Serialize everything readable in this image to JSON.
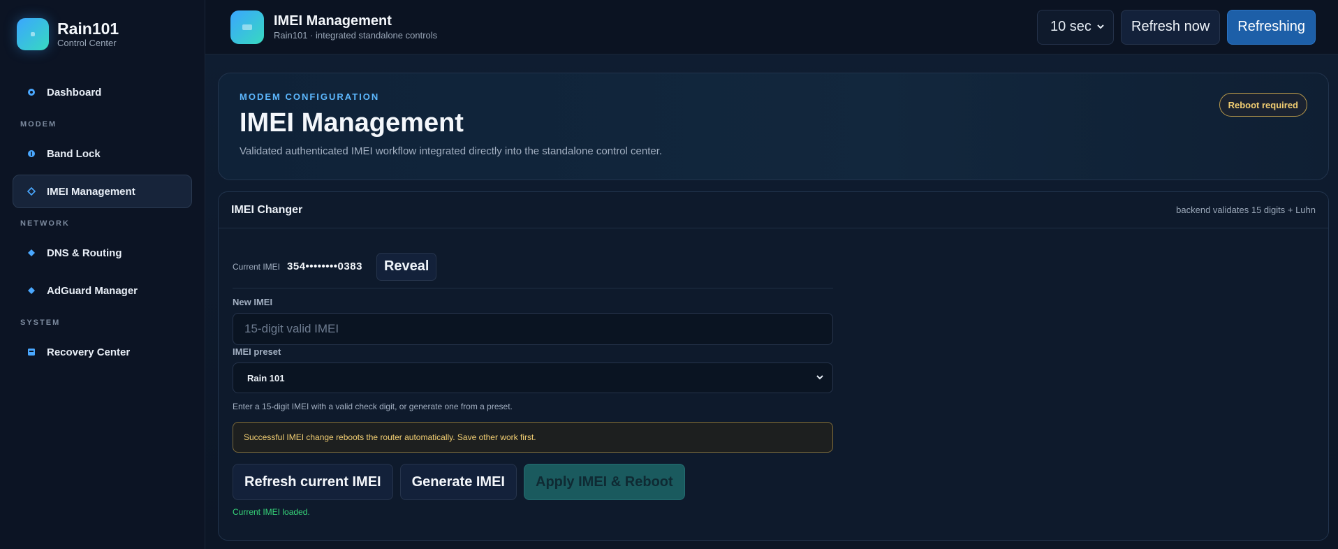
{
  "brand": {
    "name": "Rain101",
    "subtitle": "Control Center"
  },
  "sidebar": {
    "dashboard": "Dashboard",
    "sections": [
      {
        "title": "MODEM",
        "items": [
          {
            "label": "Band Lock",
            "icon": "info-circle-icon"
          },
          {
            "label": "IMEI Management",
            "icon": "diamond-outline-icon",
            "active": true
          }
        ]
      },
      {
        "title": "NETWORK",
        "items": [
          {
            "label": "DNS & Routing",
            "icon": "diamond-icon"
          },
          {
            "label": "AdGuard Manager",
            "icon": "diamond-icon"
          }
        ]
      },
      {
        "title": "SYSTEM",
        "items": [
          {
            "label": "Recovery Center",
            "icon": "square-icon"
          }
        ]
      }
    ]
  },
  "topbar": {
    "title": "IMEI Management",
    "subtitle": "Rain101 · integrated standalone controls",
    "interval": "10 sec",
    "refresh_now": "Refresh now",
    "refreshing": "Refreshing"
  },
  "hero": {
    "kicker": "MODEM CONFIGURATION",
    "title": "IMEI Management",
    "description": "Validated authenticated IMEI workflow integrated directly into the standalone control center.",
    "badge": "Reboot required"
  },
  "card": {
    "title": "IMEI Changer",
    "hint": "backend validates 15 digits + Luhn",
    "current_label": "Current IMEI",
    "current_value": "354••••••••0383",
    "reveal": "Reveal",
    "new_label": "New IMEI",
    "new_placeholder": "15-digit valid IMEI",
    "new_value": "",
    "preset_label": "IMEI preset",
    "preset_value": "Rain 101",
    "help": "Enter a 15-digit IMEI with a valid check digit, or generate one from a preset.",
    "warning": "Successful IMEI change reboots the router automatically. Save other work first.",
    "btn_refresh": "Refresh current IMEI",
    "btn_generate": "Generate IMEI",
    "btn_apply": "Apply IMEI & Reboot",
    "status": "Current IMEI loaded."
  },
  "colors": {
    "accent": "#5db8ff",
    "warning": "#f3cf73",
    "success": "#37d67a",
    "primary_button": "#1d5fa8",
    "apply_button": "#1a5a5e"
  }
}
